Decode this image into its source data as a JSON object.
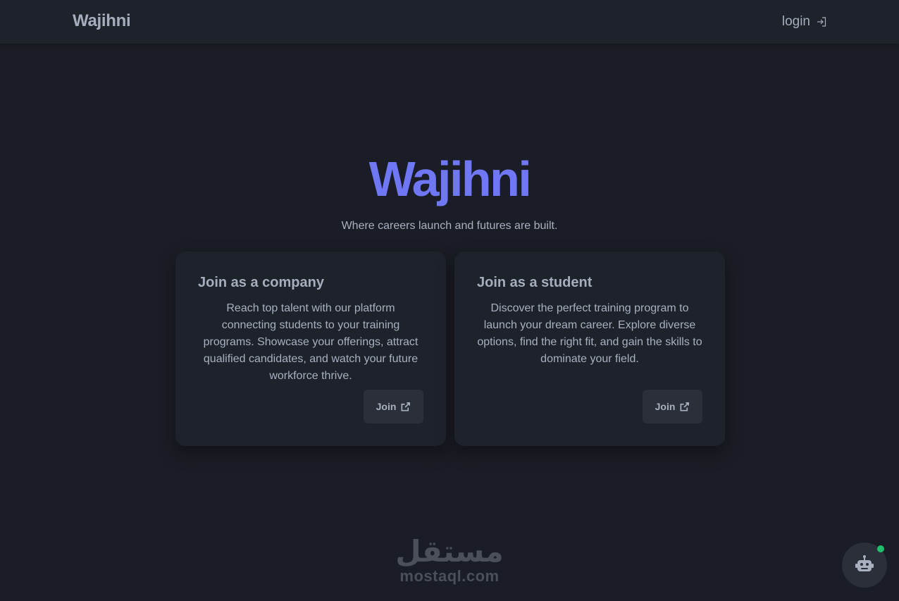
{
  "navbar": {
    "brand": "Wajihni",
    "login_label": "login",
    "login_icon": "sign-in-icon"
  },
  "hero": {
    "title": "Wajihni",
    "subtitle": "Where careers launch and futures are built."
  },
  "cards": [
    {
      "title": "Join as a company",
      "description": "Reach top talent with our platform connecting students to your training programs. Showcase your offerings, attract qualified candidates, and watch your future workforce thrive.",
      "button_label": "Join",
      "button_icon": "external-link-icon"
    },
    {
      "title": "Join as a student",
      "description": "Discover the perfect training program to launch your dream career. Explore diverse options, find the right fit, and gain the skills to dominate your field.",
      "button_label": "Join",
      "button_icon": "external-link-icon"
    }
  ],
  "watermark": {
    "arabic": "مستقل",
    "latin": "mostaql.com"
  },
  "chatbot": {
    "icon": "robot-icon",
    "status": "online"
  },
  "colors": {
    "background": "#1a1d25",
    "navbar": "#1e222b",
    "card": "#1e222b",
    "accent": "#7077f5",
    "status_online": "#1fbf6b"
  }
}
